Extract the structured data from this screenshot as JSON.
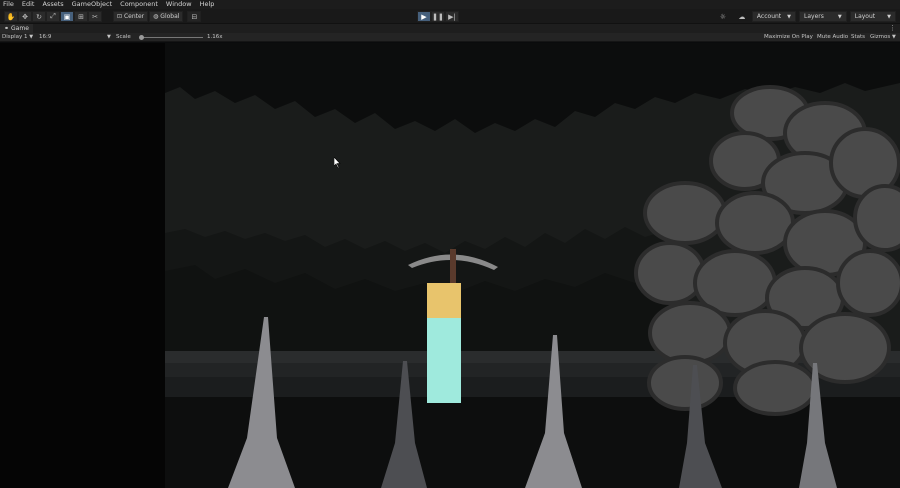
{
  "menu": [
    "File",
    "Edit",
    "Assets",
    "GameObject",
    "Component",
    "Window",
    "Help"
  ],
  "toolbar": {
    "tools": [
      "hand-tool-icon",
      "move-tool-icon",
      "rotate-tool-icon",
      "scale-tool-icon",
      "rect-tool-icon",
      "transform-tool-icon",
      "custom-tool-icon"
    ],
    "pivot": "Center",
    "space": "Global",
    "account": "Account",
    "layers": "Layers",
    "layout": "Layout"
  },
  "tab": {
    "title": "Game"
  },
  "gamebar": {
    "display": "Display 1",
    "aspect": "16:9",
    "scale_label": "Scale",
    "scale_value": "1.16x",
    "maximize": "Maximize On Play",
    "mute": "Mute Audio",
    "stats": "Stats",
    "gizmos": "Gizmos"
  },
  "colors": {
    "player_head": "#e8c46c",
    "player_body": "#9feadd",
    "rock": "#4a4a4a",
    "spike": "#8c8c90",
    "active_tool": "#46607c"
  }
}
